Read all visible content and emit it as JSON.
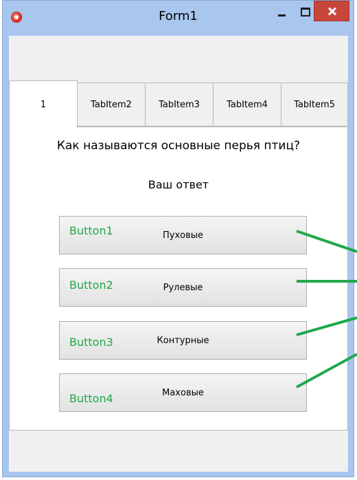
{
  "window": {
    "title": "Form1"
  },
  "tabs": [
    {
      "label": "1",
      "active": true
    },
    {
      "label": "TabItem2"
    },
    {
      "label": "TabItem3"
    },
    {
      "label": "TabItem4"
    },
    {
      "label": "TabItem5"
    }
  ],
  "content": {
    "question": "Как называются основные перья птиц?",
    "answer_label": "Ваш ответ"
  },
  "buttons": [
    {
      "name": "Button1",
      "text": "Пуховые"
    },
    {
      "name": "Button2",
      "text": "Рулевые"
    },
    {
      "name": "Button3",
      "text": "Контурные"
    },
    {
      "name": "Button4",
      "text": "Маховые"
    }
  ],
  "colors": {
    "annotation": "#1fa84a",
    "close_button": "#c7463a",
    "window_frame": "#a9c6ee"
  }
}
